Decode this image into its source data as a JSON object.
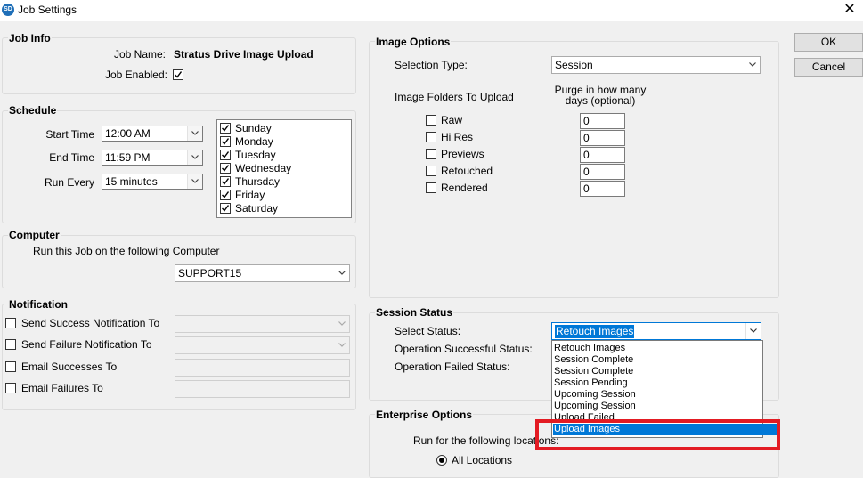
{
  "window": {
    "title": "Job Settings",
    "icon": "app-logo-icon",
    "close": "✕"
  },
  "buttons": {
    "ok": "OK",
    "cancel": "Cancel"
  },
  "job_info": {
    "label": "Job Info",
    "name_label": "Job Name:",
    "name_value": "Stratus Drive Image Upload",
    "enabled_label": "Job Enabled:",
    "enabled": true
  },
  "schedule": {
    "label": "Schedule",
    "start_label": "Start Time",
    "start_value": "12:00 AM",
    "end_label": "End Time",
    "end_value": "11:59 PM",
    "every_label": "Run Every",
    "every_value": "15 minutes",
    "days": [
      {
        "name": "Sunday",
        "checked": true
      },
      {
        "name": "Monday",
        "checked": true
      },
      {
        "name": "Tuesday",
        "checked": true
      },
      {
        "name": "Wednesday",
        "checked": true
      },
      {
        "name": "Thursday",
        "checked": true
      },
      {
        "name": "Friday",
        "checked": true
      },
      {
        "name": "Saturday",
        "checked": true
      }
    ]
  },
  "computer": {
    "label": "Computer",
    "prompt": "Run this Job on the following Computer",
    "value": "SUPPORT15"
  },
  "notification": {
    "label": "Notification",
    "success_label": "Send Success Notification To",
    "failure_label": "Send Failure Notification To",
    "email_success_label": "Email Successes To",
    "email_failure_label": "Email Failures To"
  },
  "image_options": {
    "label": "Image Options",
    "selection_type_label": "Selection Type:",
    "selection_type_value": "Session",
    "folders_label": "Image Folders To Upload",
    "purge_label": "Purge in how many days (optional)",
    "folders": [
      {
        "name": "Raw",
        "checked": false,
        "purge": "0"
      },
      {
        "name": "Hi Res",
        "checked": false,
        "purge": "0"
      },
      {
        "name": "Previews",
        "checked": false,
        "purge": "0"
      },
      {
        "name": "Retouched",
        "checked": false,
        "purge": "0"
      },
      {
        "name": "Rendered",
        "checked": false,
        "purge": "0"
      }
    ]
  },
  "session_status": {
    "label": "Session Status",
    "select_label": "Select Status:",
    "select_value": "Retouch Images",
    "success_label": "Operation Successful Status:",
    "failed_label": "Operation Failed Status:",
    "options": [
      "Retouch Images",
      "Session Complete",
      "Session Complete",
      "Session Pending",
      "Upcoming Session",
      "Upcoming Session",
      "Upload Failed",
      "Upload Images"
    ],
    "highlighted": "Upload Images"
  },
  "enterprise": {
    "label": "Enterprise Options",
    "run_for_label": "Run for the following locations:",
    "all_locations": "All Locations"
  },
  "colors": {
    "highlight": "#0078d7",
    "annotation_box": "#e31b23"
  }
}
